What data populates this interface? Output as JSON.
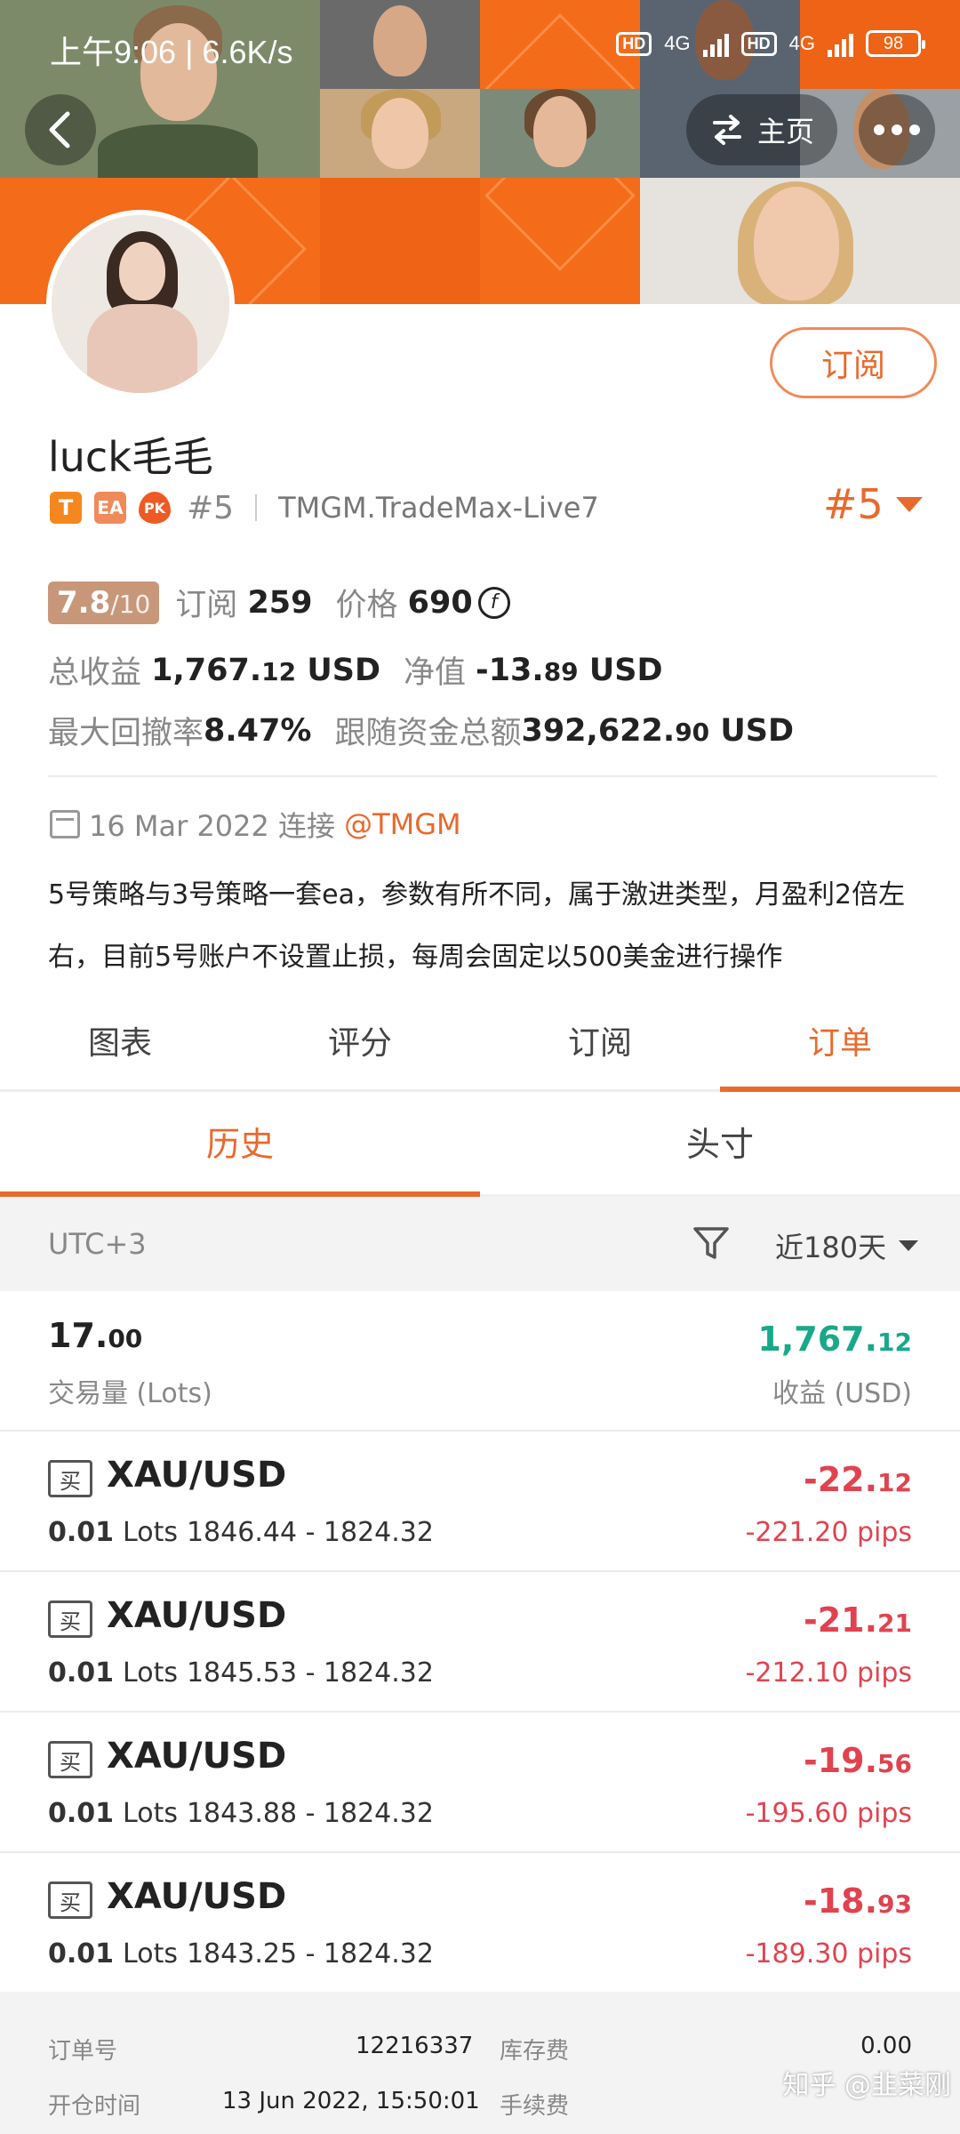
{
  "status_bar": {
    "time": "上午9:06 | 6.6K/s",
    "net1": "4G",
    "net2": "4G",
    "hd": "HD",
    "battery": "98"
  },
  "nav": {
    "home_label": "主页"
  },
  "profile": {
    "name": "luck毛毛",
    "subscribe_label": "订阅",
    "badges": [
      "T",
      "EA",
      "PK"
    ],
    "rank": "#5",
    "server": "TMGM.TradeMax-Live7",
    "rank_right": "#5",
    "score": "7.8",
    "score_max": "/10",
    "subscriptions_label": "订阅",
    "subscriptions": "259",
    "price_label": "价格",
    "price": "690",
    "total_profit_label": "总收益",
    "total_profit_int": "1,767.",
    "total_profit_dec": "12",
    "total_profit_unit": "USD",
    "net_label": "净值",
    "net_int": "-13.",
    "net_dec": "89",
    "net_unit": "USD",
    "max_drawdown_label": "最大回撤率",
    "max_drawdown": "8.47%",
    "follow_funds_label": "跟随资金总额",
    "follow_funds_int": "392,622.",
    "follow_funds_dec": "90",
    "follow_funds_unit": "USD",
    "join_date": "16 Mar 2022 连接",
    "join_broker": "@TMGM",
    "description": "5号策略与3号策略一套ea，参数有所不同，属于激进类型，月盈利2倍左右，目前5号账户不设置止损，每周会固定以500美金进行操作"
  },
  "tabs": [
    {
      "label": "图表",
      "active": false
    },
    {
      "label": "评分",
      "active": false
    },
    {
      "label": "订阅",
      "active": false
    },
    {
      "label": "订单",
      "active": true
    }
  ],
  "subtabs": [
    {
      "label": "历史",
      "active": true
    },
    {
      "label": "头寸",
      "active": false
    }
  ],
  "filter": {
    "timezone": "UTC+3",
    "range": "近180天"
  },
  "summary": {
    "lots_int": "17.",
    "lots_dec": "00",
    "lots_label": "交易量 (Lots)",
    "profit_int": "1,767.",
    "profit_dec": "12",
    "profit_label": "收益 (USD)"
  },
  "orders": [
    {
      "side": "买",
      "symbol": "XAU/USD",
      "lots": "0.01",
      "lots_unit": "Lots",
      "prices": "1846.44 - 1824.32",
      "profit_int": "-22.",
      "profit_dec": "12",
      "pips": "-221.20 pips"
    },
    {
      "side": "买",
      "symbol": "XAU/USD",
      "lots": "0.01",
      "lots_unit": "Lots",
      "prices": "1845.53 - 1824.32",
      "profit_int": "-21.",
      "profit_dec": "21",
      "pips": "-212.10 pips"
    },
    {
      "side": "买",
      "symbol": "XAU/USD",
      "lots": "0.01",
      "lots_unit": "Lots",
      "prices": "1843.88 - 1824.32",
      "profit_int": "-19.",
      "profit_dec": "56",
      "pips": "-195.60 pips"
    },
    {
      "side": "买",
      "symbol": "XAU/USD",
      "lots": "0.01",
      "lots_unit": "Lots",
      "prices": "1843.25 - 1824.32",
      "profit_int": "-18.",
      "profit_dec": "93",
      "pips": "-189.30 pips"
    }
  ],
  "detail": {
    "order_no_label": "订单号",
    "order_no": "12216337",
    "swap_label": "库存费",
    "swap": "0.00",
    "open_time_label": "开仓时间",
    "open_time": "13 Jun 2022, 15:50:01",
    "fee_label": "手续费"
  },
  "watermark": "知乎 @韭菜刚"
}
